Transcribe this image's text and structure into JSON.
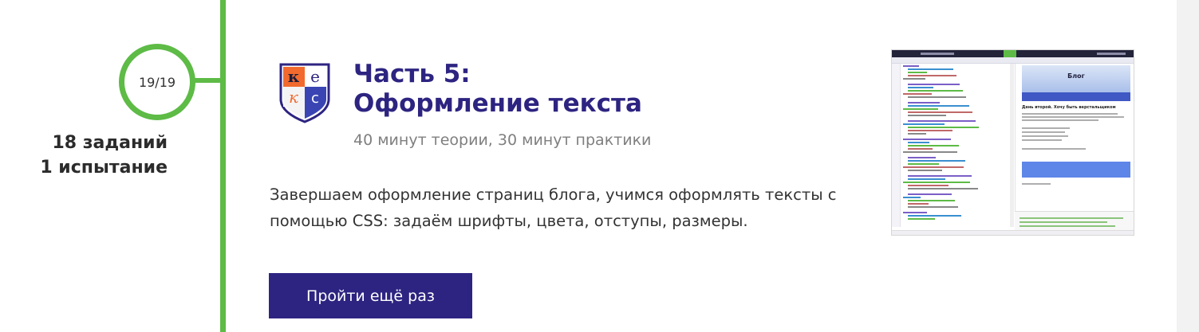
{
  "progress": {
    "label": "19/19",
    "accent_color": "#5dbb46"
  },
  "stats": {
    "tasks": "18 заданий",
    "challenges": "1 испытание"
  },
  "lesson": {
    "logo_icon": "keks-shield-logo-icon",
    "title_line1": "Часть 5:",
    "title_line2": "Оформление текста",
    "duration": "40 минут теории, 30 минут практики",
    "description": "Завершаем оформление страниц блога, учимся оформлять тексты с помощью CSS: задаём шрифты, цвета, отступы, размеры.",
    "button_label": "Пройти ещё раз",
    "brand_color": "#2d2481"
  },
  "preview": {
    "header_title": "Блог",
    "post_heading": "День второй. Хочу быть верстальщиком",
    "preview_icon": "code-editor-screenshot-thumbnail"
  }
}
